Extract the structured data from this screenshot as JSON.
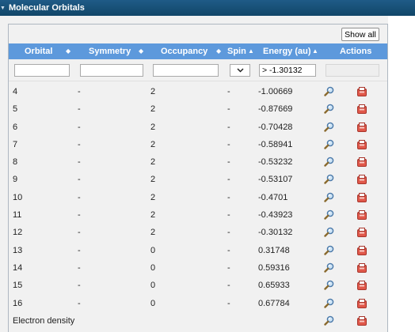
{
  "panel": {
    "title": "Molecular Orbitals"
  },
  "toolbar": {
    "show_all_label": "Show all"
  },
  "columns": {
    "orbital": "Orbital",
    "symmetry": "Symmetry",
    "occupancy": "Occupancy",
    "spin": "Spin",
    "energy": "Energy (au)",
    "actions": "Actions"
  },
  "sort_glyphs": {
    "both": "◆",
    "asc": "▲"
  },
  "filters": {
    "orbital": "",
    "symmetry": "",
    "occupancy": "",
    "spin_selected": "",
    "energy": "> -1.30132"
  },
  "rows": [
    {
      "orbital": "4",
      "symmetry": "-",
      "occupancy": "2",
      "spin": "-",
      "energy": "-1.00669"
    },
    {
      "orbital": "5",
      "symmetry": "-",
      "occupancy": "2",
      "spin": "-",
      "energy": "-0.87669"
    },
    {
      "orbital": "6",
      "symmetry": "-",
      "occupancy": "2",
      "spin": "-",
      "energy": "-0.70428"
    },
    {
      "orbital": "7",
      "symmetry": "-",
      "occupancy": "2",
      "spin": "-",
      "energy": "-0.58941"
    },
    {
      "orbital": "8",
      "symmetry": "-",
      "occupancy": "2",
      "spin": "-",
      "energy": "-0.53232"
    },
    {
      "orbital": "9",
      "symmetry": "-",
      "occupancy": "2",
      "spin": "-",
      "energy": "-0.53107"
    },
    {
      "orbital": "10",
      "symmetry": "-",
      "occupancy": "2",
      "spin": "-",
      "energy": "-0.4701"
    },
    {
      "orbital": "11",
      "symmetry": "-",
      "occupancy": "2",
      "spin": "-",
      "energy": "-0.43923"
    },
    {
      "orbital": "12",
      "symmetry": "-",
      "occupancy": "2",
      "spin": "-",
      "energy": "-0.30132"
    },
    {
      "orbital": "13",
      "symmetry": "-",
      "occupancy": "0",
      "spin": "-",
      "energy": "0.31748"
    },
    {
      "orbital": "14",
      "symmetry": "-",
      "occupancy": "0",
      "spin": "-",
      "energy": "0.59316"
    },
    {
      "orbital": "15",
      "symmetry": "-",
      "occupancy": "0",
      "spin": "-",
      "energy": "0.65933"
    },
    {
      "orbital": "16",
      "symmetry": "-",
      "occupancy": "0",
      "spin": "-",
      "energy": "0.67784"
    },
    {
      "orbital": "Electron density",
      "symmetry": "",
      "occupancy": "",
      "spin": "",
      "energy": ""
    }
  ],
  "icons": {
    "view": "magnifier-icon",
    "download": "download-icon"
  },
  "colors": {
    "header_bar": "#114668",
    "table_head": "#5d99dc",
    "table_bg": "#f1f1f1",
    "download_icon": "#e0584a"
  }
}
